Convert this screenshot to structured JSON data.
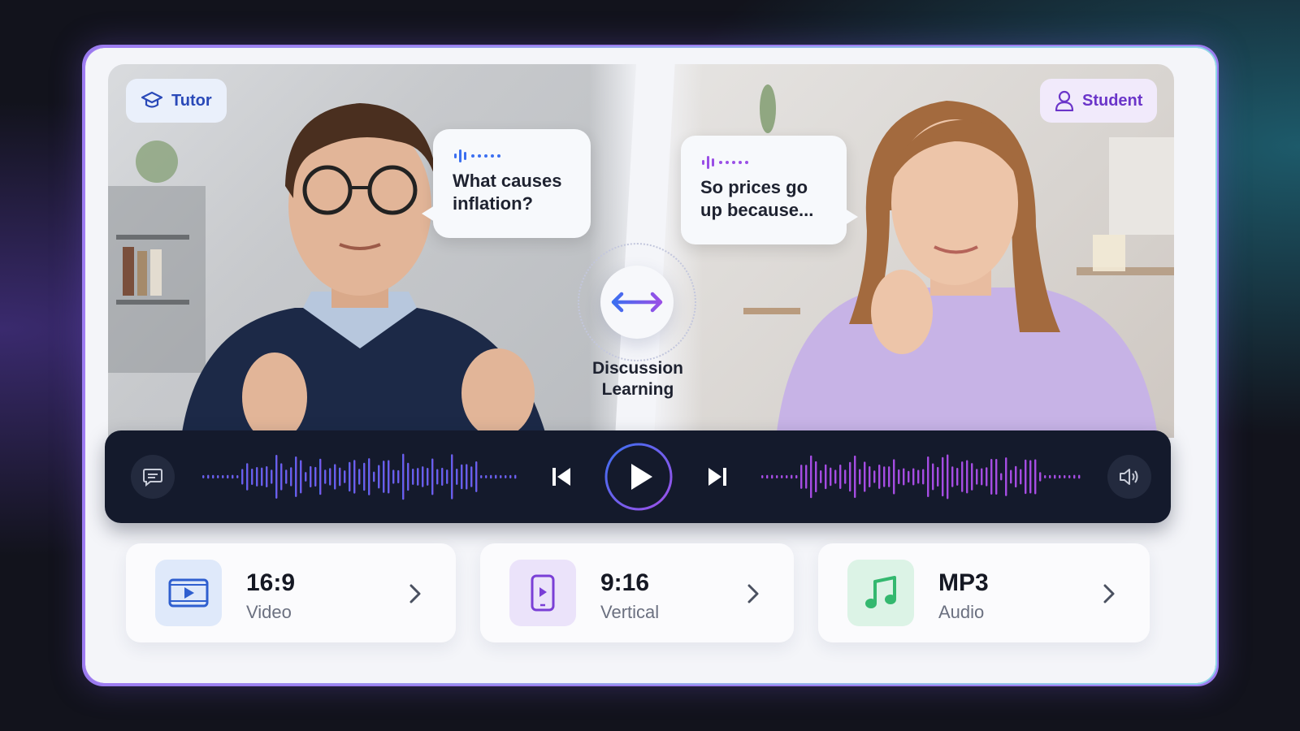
{
  "badges": {
    "tutor": "Tutor",
    "student": "Student"
  },
  "bubbles": {
    "tutor": "What causes inflation?",
    "student": "So prices go up because..."
  },
  "center": {
    "line1": "Discussion",
    "line2": "Learning"
  },
  "formats": [
    {
      "title": "16:9",
      "subtitle": "Video",
      "icon": "video-play-icon"
    },
    {
      "title": "9:16",
      "subtitle": "Vertical",
      "icon": "phone-vertical-icon"
    },
    {
      "title": "MP3",
      "subtitle": "Audio",
      "icon": "music-note-icon"
    }
  ],
  "player": {
    "state": "paused"
  },
  "colors": {
    "tutor": "#3b6ff0",
    "student": "#9a4fe6",
    "audio": "#39c07a",
    "player_bg": "#141a2c"
  }
}
